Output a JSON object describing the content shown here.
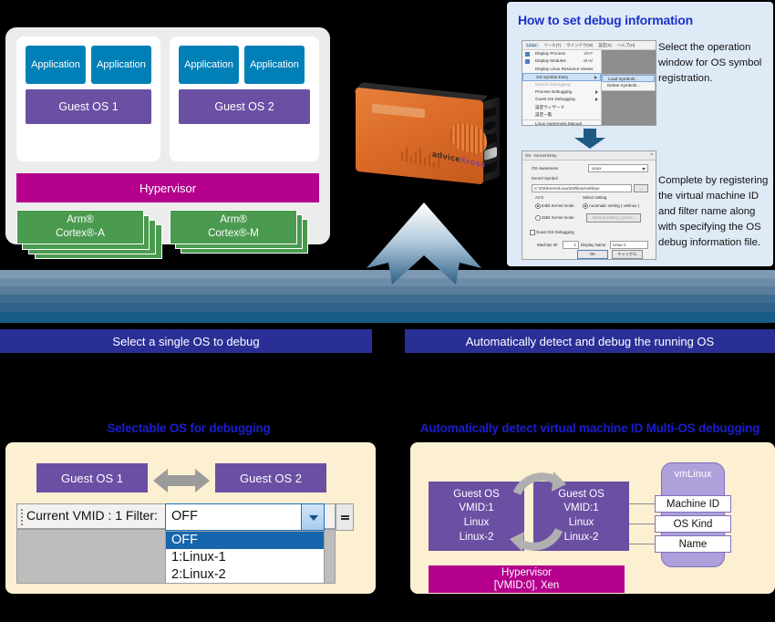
{
  "architecture": {
    "guest_groups": [
      {
        "os_label": "Guest OS 1",
        "apps": [
          "Application",
          "Application"
        ]
      },
      {
        "os_label": "Guest OS 2",
        "apps": [
          "Application",
          "Application"
        ]
      }
    ],
    "hypervisor_label": "Hypervisor",
    "cpus": [
      {
        "line1": "Arm®",
        "line2": "Cortex®-A"
      },
      {
        "line1": "Arm®",
        "line2": "Cortex®-M"
      }
    ],
    "colors": {
      "application": "#0080b6",
      "guest_os": "#6a4fa3",
      "hypervisor": "#b5008e",
      "cpu": "#4a9a4f",
      "panel": "#ececec"
    }
  },
  "device": {
    "brand_advice": "advice",
    "brand_xross": "Xross"
  },
  "howto": {
    "title": "How to set debug information",
    "step1_text": "Select the operation window for OS symbol registration.",
    "step2_text": "Complete by registering the virtual machine ID and filter name along with specifying the OS debug information file.",
    "menu_screenshot": {
      "menubar": [
        "Linux",
        "ツール(T)",
        "ウインドウ(W)",
        "設定(S)",
        "ヘルプ(H)"
      ],
      "items": [
        {
          "label": "Display Process",
          "accel": "alt+P",
          "check": true
        },
        {
          "label": "Display Modules",
          "accel": "alt+M",
          "check": true
        },
        {
          "label": "Display Linux Resource Viewer",
          "accel": "",
          "check": false
        },
        {
          "label": "OS Symbol Entry",
          "accel": "",
          "submenu": true,
          "selected": true
        },
        {
          "label": "Module Debugging",
          "accel": "",
          "disabled": true
        },
        {
          "label": "Process Debugging",
          "accel": "",
          "submenu": true
        },
        {
          "label": "Guest OS Debugging",
          "accel": "",
          "submenu": true
        },
        {
          "label": "設定ウィザード",
          "accel": ""
        },
        {
          "label": "設定一覧",
          "accel": ""
        },
        {
          "label": "Linux Awareness Manual",
          "accel": ""
        }
      ],
      "submenu_items": [
        "Load Symbols...",
        "Delete Symbols..."
      ]
    },
    "dialog_screenshot": {
      "title": "OS - Kernel Entry",
      "close_label": "×",
      "field_os_awareness_label": "OS Awareness",
      "field_os_awareness_value": "Linux",
      "field_kernel_symbol_label": "Kernel Symbol",
      "field_kernel_symbol_value": "C:\\ICE\\Kerne\\Linux\\OS\\linux\\vmlinux",
      "browse_label": "...",
      "group_arch_label": "Arch",
      "radio_64bit": "64bit Kernel mode",
      "radio_32bit": "32bit Kernel mode",
      "group_select_label": "Select setting",
      "radio_auto": "Automatic setting ( vmlinux )",
      "radio_manual": "Manual setting ( preset )",
      "checkbox_guest_os": "Guest OS Debugging",
      "machine_id_label": "Machine ID:",
      "machine_id_value": "1",
      "display_name_label": "Display Name:",
      "display_name_value": "Linux-1",
      "ok_label": "OK",
      "cancel_label": "キャンセル"
    }
  },
  "banners": {
    "left": "Select a single OS to debug",
    "right": "Automatically detect and debug the running OS",
    "color": "#2a2f96"
  },
  "left_section": {
    "title": "Selectable OS for debugging",
    "guest_os_1": "Guest OS 1",
    "guest_os_2": "Guest OS 2",
    "toolbar_label": "Current VMID : 1  Filter:",
    "combo_value": "OFF",
    "dropdown_options": [
      "OFF",
      "1:Linux-1",
      "2:Linux-2"
    ],
    "selected_option": "OFF",
    "overflow_label": "▾"
  },
  "right_section": {
    "title": "Automatically detect virtual machine ID Multi-OS debugging",
    "guest_box_left": "Guest OS\nVMID:1\nLinux\nLinux-2",
    "guest_box_right": "Guest OS\nVMID:1\nLinux\nLinux-2",
    "hypervisor_label": "Hypervisor\n[VMID:0], Xen",
    "vm_pill_label": "vmLinux",
    "attributes": [
      "Machine ID",
      "OS Kind",
      "Name"
    ]
  }
}
